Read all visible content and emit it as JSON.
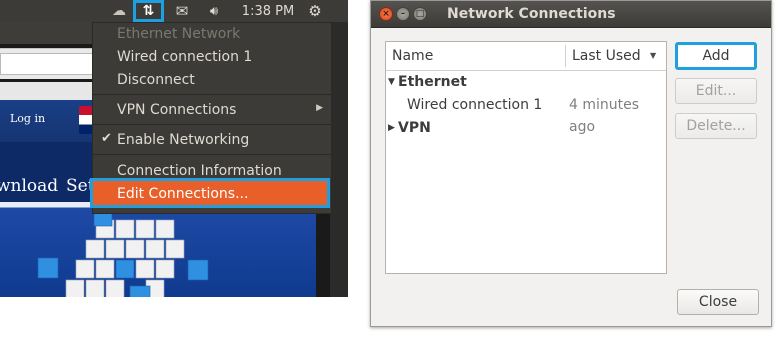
{
  "top_panel": {
    "clock": "1:38 PM",
    "icons": [
      "cloud-icon",
      "network-updown-icon",
      "mail-icon",
      "volume-icon",
      "settings-gear-icon"
    ],
    "highlight_color": "#1ea0e0"
  },
  "browser": {
    "login_link": "Log in",
    "nav_download": "wnload",
    "nav_settings": "Set"
  },
  "indicator_menu": {
    "section_header": "Ethernet Network",
    "items": [
      {
        "label": "Wired connection 1",
        "enabled": true
      },
      {
        "label": "Disconnect",
        "enabled": true
      },
      {
        "label": "VPN Connections",
        "submenu": true
      },
      {
        "label": "Enable Networking",
        "checked": true
      },
      {
        "label": "Connection Information",
        "enabled": true
      },
      {
        "label": "Edit Connections...",
        "highlighted": true
      }
    ],
    "highlight_color": "#e95f2a"
  },
  "dialog": {
    "title": "Network Connections",
    "columns": {
      "name": "Name",
      "last_used": "Last Used"
    },
    "groups": [
      {
        "label": "Ethernet",
        "expanded": true,
        "connections": [
          {
            "name": "Wired connection 1",
            "last_used": "4 minutes ago"
          }
        ]
      },
      {
        "label": "VPN",
        "expanded": false,
        "connections": []
      }
    ],
    "buttons": {
      "add": "Add",
      "edit": "Edit...",
      "delete": "Delete...",
      "close": "Close"
    }
  }
}
